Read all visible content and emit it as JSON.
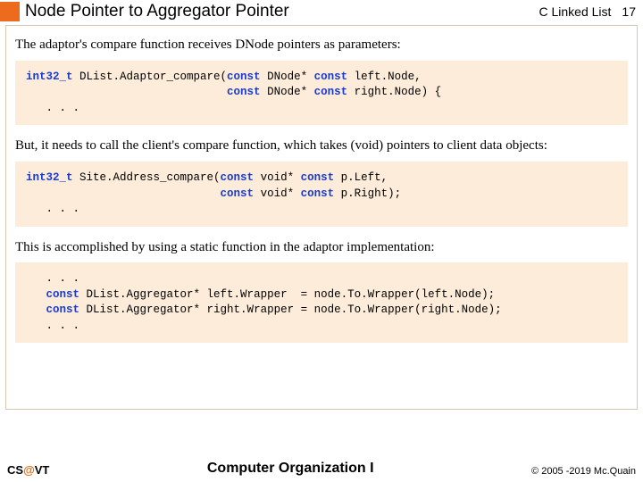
{
  "header": {
    "title": "Node Pointer to Aggregator Pointer",
    "subject": "C Linked List",
    "pagenum": "17"
  },
  "para1": "The adaptor's compare function receives DNode pointers as parameters:",
  "code1": {
    "kw_int32": "int32_t",
    "fn": " DList.Adaptor_compare(",
    "kw_c1": "const",
    "t1": " DNode* ",
    "kw_c2": "const",
    "p1": " left.Node,",
    "pad1": "                              ",
    "kw_c3": "const",
    "t2": " DNode* ",
    "kw_c4": "const",
    "p2": " right.Node) {",
    "dots": "   . . ."
  },
  "para2": "But, it needs to call the client's compare function, which takes (void) pointers to client data objects:",
  "code2": {
    "kw_int32": "int32_t",
    "fn": " Site.Address_compare(",
    "kw_c1": "const",
    "t1": " void* ",
    "kw_c2": "const",
    "p1": " p.Left,",
    "pad1": "                             ",
    "kw_c3": "const",
    "t2": " void* ",
    "kw_c4": "const",
    "p2": " p.Right);",
    "dots": "   . . ."
  },
  "para3": "This is accomplished by using a static function in the adaptor implementation:",
  "code3": {
    "dots1": "   . . .",
    "pad": "   ",
    "kw_c1": "const",
    "l1": " DList.Aggregator* left.Wrapper  = node.To.Wrapper(left.Node);",
    "kw_c2": "const",
    "l2": " DList.Aggregator* right.Wrapper = node.To.Wrapper(right.Node);",
    "dots2": "   . . ."
  },
  "footer": {
    "left_cs": "CS",
    "left_at": "@",
    "left_vt": "VT",
    "center": "Computer Organization I",
    "right": "© 2005 -2019 Mc.Quain"
  }
}
